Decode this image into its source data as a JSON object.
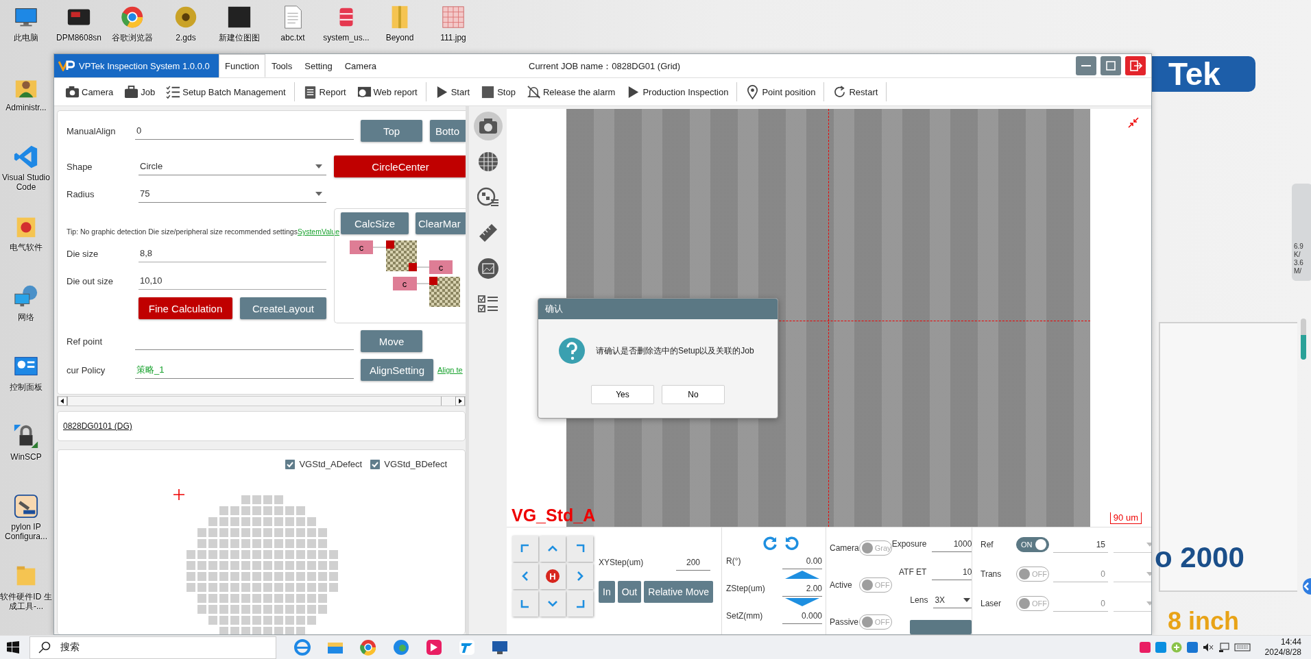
{
  "desktop": {
    "top_row": [
      {
        "label": "此电脑",
        "kind": "computer"
      },
      {
        "label": "DPM8608sn",
        "kind": "device"
      },
      {
        "label": "谷歌浏览器",
        "kind": "browser"
      },
      {
        "label": "2.gds",
        "kind": "disc"
      },
      {
        "label": "新建位图图",
        "kind": "image"
      },
      {
        "label": "abc.txt",
        "kind": "text"
      },
      {
        "label": "system_us...",
        "kind": "database"
      },
      {
        "label": "Beyond",
        "kind": "folder"
      },
      {
        "label": "111.jpg",
        "kind": "grid"
      }
    ],
    "side_column": [
      {
        "label": "Administr...",
        "kind": "user"
      },
      {
        "label": "Visual Studio Code",
        "kind": "code"
      },
      {
        "label": "电气软件",
        "kind": "pdf"
      },
      {
        "label": "网络",
        "kind": "network"
      },
      {
        "label": "控制面板",
        "kind": "panel"
      },
      {
        "label": "WinSCP",
        "kind": "lock"
      },
      {
        "label": "pylon IP Configura...",
        "kind": "tool"
      },
      {
        "label": "软件硬件ID 生成工具-...",
        "kind": "folder"
      }
    ]
  },
  "backdrop": {
    "logo": "Tek",
    "model": "o 2000",
    "size": "8 inch",
    "widget": [
      "6.9",
      "K/",
      "3.6",
      "M/"
    ]
  },
  "window": {
    "title": "VPTek Inspection System 1.0.0.0",
    "menu": [
      {
        "label": "Function",
        "selected": true
      },
      {
        "label": "Tools",
        "selected": false
      },
      {
        "label": "Setting",
        "selected": false
      },
      {
        "label": "Camera",
        "selected": false
      }
    ],
    "job_name": "Current JOB name：0828DG01 (Grid)"
  },
  "toolbar": [
    {
      "label": "Camera",
      "kind": "camera",
      "divider": false
    },
    {
      "label": "Job",
      "kind": "briefcase",
      "divider": false
    },
    {
      "label": "Setup Batch Management",
      "kind": "checklist",
      "divider": true
    },
    {
      "label": "Report",
      "kind": "report",
      "divider": false
    },
    {
      "label": "Web report",
      "kind": "web",
      "divider": true
    },
    {
      "label": "Start",
      "kind": "play",
      "divider": false
    },
    {
      "label": "Stop",
      "kind": "stop",
      "divider": false
    },
    {
      "label": "Release the alarm",
      "kind": "bell",
      "divider": false
    },
    {
      "label": "Production Inspection",
      "kind": "play",
      "divider": true
    },
    {
      "label": "Point position",
      "kind": "pin",
      "divider": true
    },
    {
      "label": "Restart",
      "kind": "restart",
      "divider": true
    }
  ],
  "align_form": {
    "manual_align": {
      "label": "ManualAlign",
      "value": "0"
    },
    "side_buttons": [
      "Top",
      "Botto"
    ],
    "shape": {
      "label": "Shape",
      "value": "Circle"
    },
    "circle_center_button": "CircleCenter",
    "radius": {
      "label": "Radius",
      "value": "75"
    },
    "tip": "Tip: No graphic detection Die size/peripheral size recommended settings",
    "tip_link": "SystemValue",
    "die_size": {
      "label": "Die size",
      "value": "8,8"
    },
    "die_out_size": {
      "label": "Die out size",
      "value": "10,10"
    },
    "calc_buttons": [
      "CalcSize",
      "ClearMar"
    ],
    "layout_labels": [
      "c",
      "c",
      "c"
    ],
    "fine_calculation_button": "Fine Calculation",
    "create_layout_button": "CreateLayout",
    "ref_point": {
      "label": "Ref point"
    },
    "move_button": "Move",
    "cur_policy": {
      "label": "cur Policy",
      "value": "策略_1"
    },
    "align_setting_button": "AlignSetting",
    "align_link": "Align te"
  },
  "job_item": "0828DG0101 (DG)",
  "defect_filters": [
    {
      "label": "VGStd_ADefect",
      "checked": true
    },
    {
      "label": "VGStd_BDefect",
      "checked": true
    }
  ],
  "side_tools": [
    {
      "kind": "camera",
      "selected": true
    },
    {
      "kind": "wafer",
      "selected": false
    },
    {
      "kind": "wafer-list",
      "selected": false
    },
    {
      "kind": "ruler",
      "selected": false
    },
    {
      "kind": "image",
      "selected": false
    },
    {
      "kind": "checklist",
      "selected": false
    }
  ],
  "image_view": {
    "recipe": "VG_Std_A",
    "scale": "90 um"
  },
  "dialog": {
    "title": "确认",
    "message": "请确认是否删除选中的Setup以及关联的Job",
    "buttons": [
      "Yes",
      "No"
    ]
  },
  "motion": {
    "home": "H",
    "xy_step": {
      "label": "XYStep(um)",
      "value": "200"
    },
    "buttons": [
      "In",
      "Out",
      "Relative Move"
    ],
    "rotation": {
      "label": "R(°)",
      "value": "0.00"
    },
    "z_step": {
      "label": "ZStep(um)",
      "value": "2.00"
    },
    "set_z": {
      "label": "SetZ(mm)",
      "value": "0.000"
    }
  },
  "camera_modes": [
    {
      "label": "Camera",
      "toggle": "Gray",
      "on": false
    },
    {
      "label": "Active",
      "toggle": "OFF",
      "on": false
    },
    {
      "label": "Passive",
      "toggle": "OFF",
      "on": false
    }
  ],
  "exposure": {
    "label": "Exposure",
    "value": "1000"
  },
  "atf_et": {
    "label": "ATF ET",
    "value": "10"
  },
  "lens": {
    "label": "Lens",
    "value": "3X"
  },
  "lights": [
    {
      "label": "Ref",
      "toggle": "ON",
      "on": true,
      "value": "15"
    },
    {
      "label": "Trans",
      "toggle": "OFF",
      "on": false,
      "value": "0"
    },
    {
      "label": "Laser",
      "toggle": "OFF",
      "on": false,
      "value": "0"
    }
  ],
  "taskbar": {
    "search": "搜索",
    "apps": [
      {
        "kind": "ie"
      },
      {
        "kind": "folder"
      },
      {
        "kind": "chrome"
      },
      {
        "kind": "edge"
      },
      {
        "kind": "pink"
      },
      {
        "kind": "blue"
      },
      {
        "kind": "remote"
      }
    ],
    "time": "14:44",
    "date": "2024/8/28"
  }
}
